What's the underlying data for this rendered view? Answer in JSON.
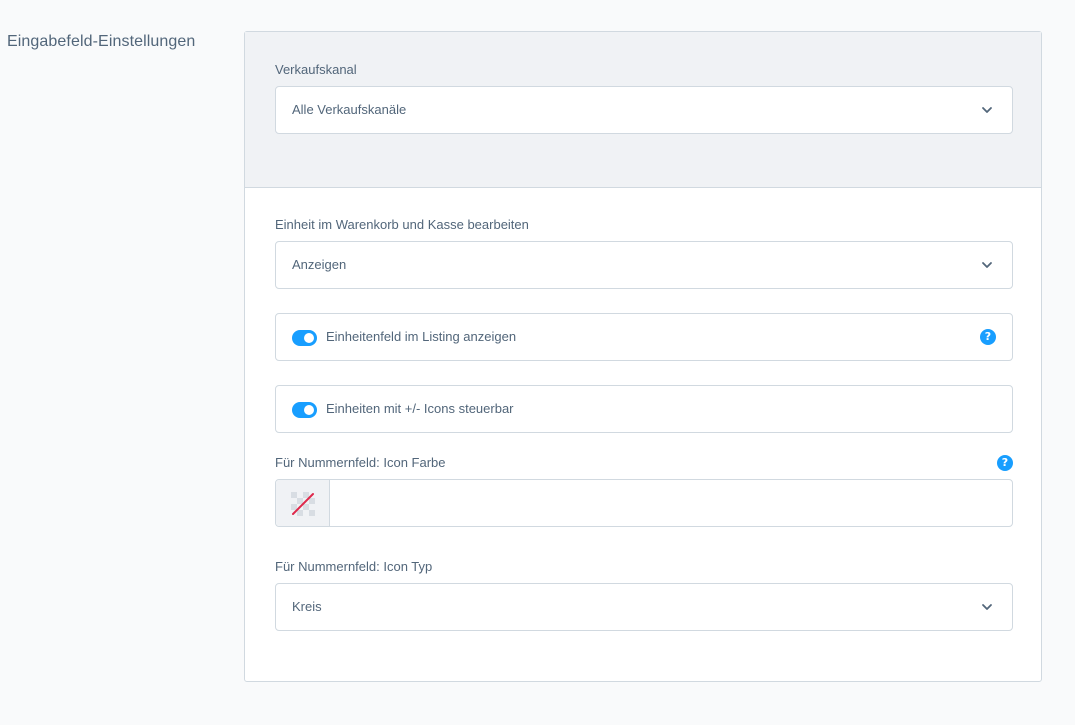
{
  "section": {
    "title": "Eingabefeld-Einstellungen"
  },
  "sales_channel": {
    "label": "Verkaufskanal",
    "value": "Alle Verkaufskanäle"
  },
  "cart_unit": {
    "label": "Einheit im Warenkorb und Kasse bearbeiten",
    "value": "Anzeigen"
  },
  "listing_switch": {
    "label": "Einheitenfeld im Listing anzeigen",
    "enabled": true,
    "help": "?"
  },
  "icons_switch": {
    "label": "Einheiten mit +/- Icons steuerbar",
    "enabled": true
  },
  "icon_color": {
    "label": "Für Nummernfeld: Icon Farbe",
    "value": "",
    "help": "?",
    "swatch_icon": "no-color-icon"
  },
  "icon_type": {
    "label": "Für Nummernfeld: Icon Typ",
    "value": "Kreis"
  },
  "colors": {
    "accent": "#189eff",
    "text": "#52667a",
    "border": "#d1d9e0",
    "header_bg": "#f0f2f5"
  }
}
